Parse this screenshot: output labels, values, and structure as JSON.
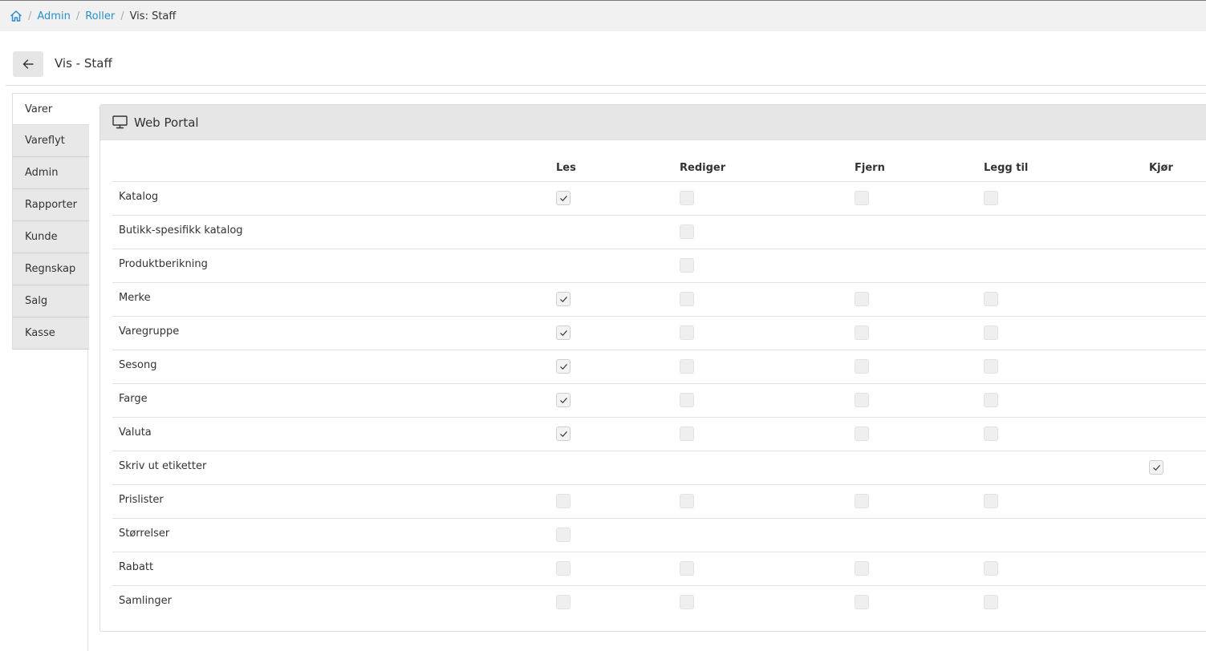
{
  "breadcrumb": {
    "home_icon": "home-icon",
    "items": [
      "Admin",
      "Roller"
    ],
    "current": "Vis: Staff"
  },
  "header": {
    "back_icon": "arrow-left-icon",
    "title": "Vis - Staff"
  },
  "tabs": [
    "Varer",
    "Vareflyt",
    "Admin",
    "Rapporter",
    "Kunde",
    "Regnskap",
    "Salg",
    "Kasse"
  ],
  "active_tab": "Varer",
  "panel": {
    "icon": "monitor-icon",
    "title": "Web Portal"
  },
  "columns": [
    "Les",
    "Rediger",
    "Fjern",
    "Legg til",
    "Kjør"
  ],
  "rows": [
    {
      "label": "Katalog",
      "cells": [
        "checked",
        "empty",
        "empty",
        "empty",
        "none"
      ]
    },
    {
      "label": "Butikk-spesifikk katalog",
      "cells": [
        "none",
        "empty",
        "none",
        "none",
        "none"
      ]
    },
    {
      "label": "Produktberikning",
      "cells": [
        "none",
        "empty",
        "none",
        "none",
        "none"
      ]
    },
    {
      "label": "Merke",
      "cells": [
        "checked",
        "empty",
        "empty",
        "empty",
        "none"
      ]
    },
    {
      "label": "Varegruppe",
      "cells": [
        "checked",
        "empty",
        "empty",
        "empty",
        "none"
      ]
    },
    {
      "label": "Sesong",
      "cells": [
        "checked",
        "empty",
        "empty",
        "empty",
        "none"
      ]
    },
    {
      "label": "Farge",
      "cells": [
        "checked",
        "empty",
        "empty",
        "empty",
        "none"
      ]
    },
    {
      "label": "Valuta",
      "cells": [
        "checked",
        "empty",
        "empty",
        "empty",
        "none"
      ]
    },
    {
      "label": "Skriv ut etiketter",
      "cells": [
        "none",
        "none",
        "none",
        "none",
        "checked"
      ]
    },
    {
      "label": "Prislister",
      "cells": [
        "empty",
        "empty",
        "empty",
        "empty",
        "none"
      ]
    },
    {
      "label": "Størrelser",
      "cells": [
        "empty",
        "none",
        "none",
        "none",
        "none"
      ]
    },
    {
      "label": "Rabatt",
      "cells": [
        "empty",
        "empty",
        "empty",
        "empty",
        "none"
      ]
    },
    {
      "label": "Samlinger",
      "cells": [
        "empty",
        "empty",
        "empty",
        "empty",
        "none"
      ]
    }
  ],
  "colors": {
    "link": "#2a8fc9",
    "breadcrumb_bg": "#f1f1f1",
    "panel_head_bg": "#e6e6e6",
    "tab_bg": "#e8e8e8"
  }
}
